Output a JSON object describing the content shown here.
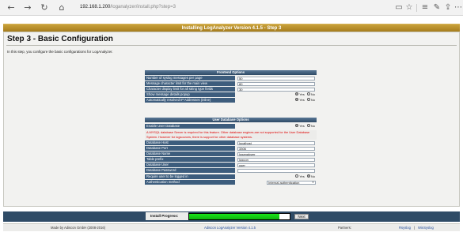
{
  "browser": {
    "url_host": "192.168.1.200",
    "url_path": "/loganalyzer/install.php?step=3",
    "nav": {
      "back": "←",
      "forward": "→",
      "reload": "↻",
      "home": "⌂"
    },
    "icons": {
      "reading": "▭",
      "favorite": "☆",
      "menu": "≡",
      "notes": "✎",
      "share": "⇪",
      "more": "⋯"
    }
  },
  "header": {
    "title": "Installing LogAnalyzer Version 4.1.5 - Step 3"
  },
  "page": {
    "heading": "Step 3 - Basic Configuration",
    "intro": "In this step, you configure the basic configurations for LogAnalyzer."
  },
  "frontend": {
    "title": "Frontend Options",
    "rows": [
      {
        "label": "Number of syslog messages per page",
        "value": "50"
      },
      {
        "label": "Message character limit for the main view",
        "value": "80"
      },
      {
        "label": "Character display limit for all string type fields",
        "value": "30"
      }
    ],
    "popup": {
      "label": "Show message details popup",
      "yes": "Yes",
      "no": "No",
      "selected": "yes"
    },
    "resolve": {
      "label": "Automatically resolved IP Addresses (inline)",
      "yes": "Yes",
      "no": "No",
      "selected": "yes"
    }
  },
  "userdb": {
    "title": "User Database Options",
    "enable": {
      "label": "Enable User Database",
      "yes": "Yes",
      "no": "No",
      "selected": "yes"
    },
    "warning": "A MYSQL database Server is required for this feature. Other database engines are not supported for the User Database System. However for logsources, there is support for other database systems.",
    "fields": [
      {
        "label": "Database Host",
        "value": "localhost"
      },
      {
        "label": "Database Port",
        "value": "3306"
      },
      {
        "label": "Database Name",
        "value": "loganalyzer"
      },
      {
        "label": "Table prefix",
        "value": "logcon_"
      },
      {
        "label": "Database User",
        "value": "user"
      },
      {
        "label": "Database Password",
        "value": ""
      }
    ],
    "require_login": {
      "label": "Require user to be logged in",
      "yes": "Yes",
      "no": "No",
      "selected": "no"
    },
    "auth_method": {
      "label": "Authentication method",
      "value": "Internal authentication"
    }
  },
  "install": {
    "progress_label": "Install Progress:",
    "progress_fraction": 0.9,
    "next_label": "Next"
  },
  "footer": {
    "made_by": "Made by Adiscon GmbH (2008-2016)",
    "product": "Adiscon LogAnalyzer Version 4.1.5",
    "partners_label": "Partners:",
    "partner1": "Rsyslog",
    "partner2": "WinSyslog",
    "separator": "|"
  },
  "colors": {
    "title_bar": "#b48a28",
    "section_header": "#3d5d7d",
    "progress": "#19e619",
    "warning": "#e00000"
  }
}
